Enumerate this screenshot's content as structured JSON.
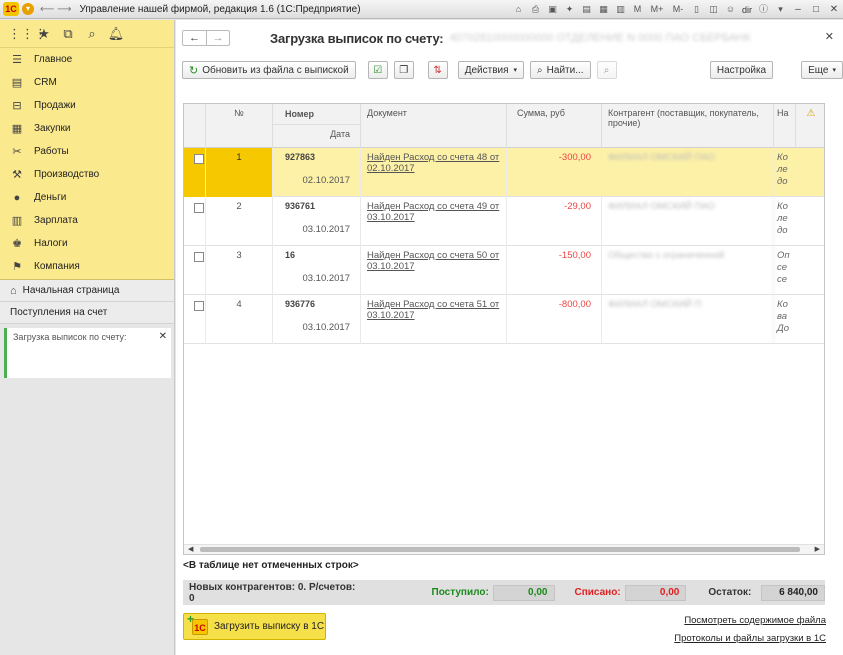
{
  "window": {
    "title": "Управление нашей фирмой, редакция 1.6  (1С:Предприятие)",
    "user": "dir",
    "toolbar_icons": [
      "home-icon",
      "print-icon",
      "save-icon",
      "calendar-icon",
      "calc-icon"
    ],
    "memory_buttons": [
      "M",
      "M+",
      "M-"
    ]
  },
  "sidebar": {
    "items": [
      {
        "label": "Главное",
        "icon": "list-icon"
      },
      {
        "label": "CRM",
        "icon": "crm-icon"
      },
      {
        "label": "Продажи",
        "icon": "sales-icon"
      },
      {
        "label": "Закупки",
        "icon": "purchases-icon"
      },
      {
        "label": "Работы",
        "icon": "tools-icon"
      },
      {
        "label": "Производство",
        "icon": "factory-icon"
      },
      {
        "label": "Деньги",
        "icon": "money-icon"
      },
      {
        "label": "Зарплата",
        "icon": "salary-icon"
      },
      {
        "label": "Налоги",
        "icon": "taxes-icon"
      },
      {
        "label": "Компания",
        "icon": "company-icon"
      }
    ],
    "home": "Начальная страница",
    "receipts": "Поступления на счет",
    "open_window": "Загрузка выписок по счету:"
  },
  "form": {
    "title": "Загрузка выписок по счету:",
    "account": "40702810000000000  ОТДЕЛЕНИЕ N 0000 ПАО СБЕРБАНК",
    "buttons": {
      "refresh": "Обновить из файла с выпиской",
      "actions": "Действия",
      "find": "Найти...",
      "settings": "Настройка",
      "more": "Еще"
    }
  },
  "table": {
    "headers": {
      "num": "№",
      "number": "Номер",
      "date": "Дата",
      "document": "Документ",
      "sum": "Сумма, руб",
      "counterparty": "Контрагент (поставщик, покупатель, прочие)",
      "purpose": "На"
    },
    "rows": [
      {
        "n": "1",
        "number": "927863",
        "date": "02.10.2017",
        "doc": "Найден Расход со счета 48 от 02.10.2017",
        "sum": "-300,00",
        "cp": "ФИЛИАЛ ОМСКИЙ ПАО",
        "purpose": "Ко ле до",
        "selected": true
      },
      {
        "n": "2",
        "number": "936761",
        "date": "03.10.2017",
        "doc": "Найден Расход со счета 49 от 03.10.2017",
        "sum": "-29,00",
        "cp": "ФИЛИАЛ ОМСКИЙ ПАО",
        "purpose": "Ко ле до",
        "selected": false
      },
      {
        "n": "3",
        "number": "16",
        "date": "03.10.2017",
        "doc": "Найден Расход со счета 50 от 03.10.2017",
        "sum": "-150,00",
        "cp": "Общество с ограниченной",
        "purpose": "Оп се се",
        "selected": false
      },
      {
        "n": "4",
        "number": "936776",
        "date": "03.10.2017",
        "doc": "Найден Расход со счета 51 от 03.10.2017",
        "sum": "-800,00",
        "cp": "ФИЛИАЛ ОМСКИЙ П",
        "purpose": "Ко ва До",
        "selected": false
      }
    ]
  },
  "footer": {
    "no_marked": "<В таблице нет отмеченных строк>",
    "new_counterparties": "Новых контрагентов: 0. Р/счетов: 0",
    "received_label": "Поступило:",
    "received_value": "0,00",
    "debited_label": "Списано:",
    "debited_value": "0,00",
    "balance_label": "Остаток:",
    "balance_value": "6 840,00",
    "load_button": "Загрузить выписку в 1С",
    "view_file_link": "Посмотреть содержимое файла",
    "protocols_link": "Протоколы и файлы загрузки в 1С"
  },
  "colors": {
    "accent_yellow": "#fbe98d",
    "selected_row": "#fdf1a8",
    "received_green": "#1a8a1a",
    "debited_red": "#e02020"
  }
}
